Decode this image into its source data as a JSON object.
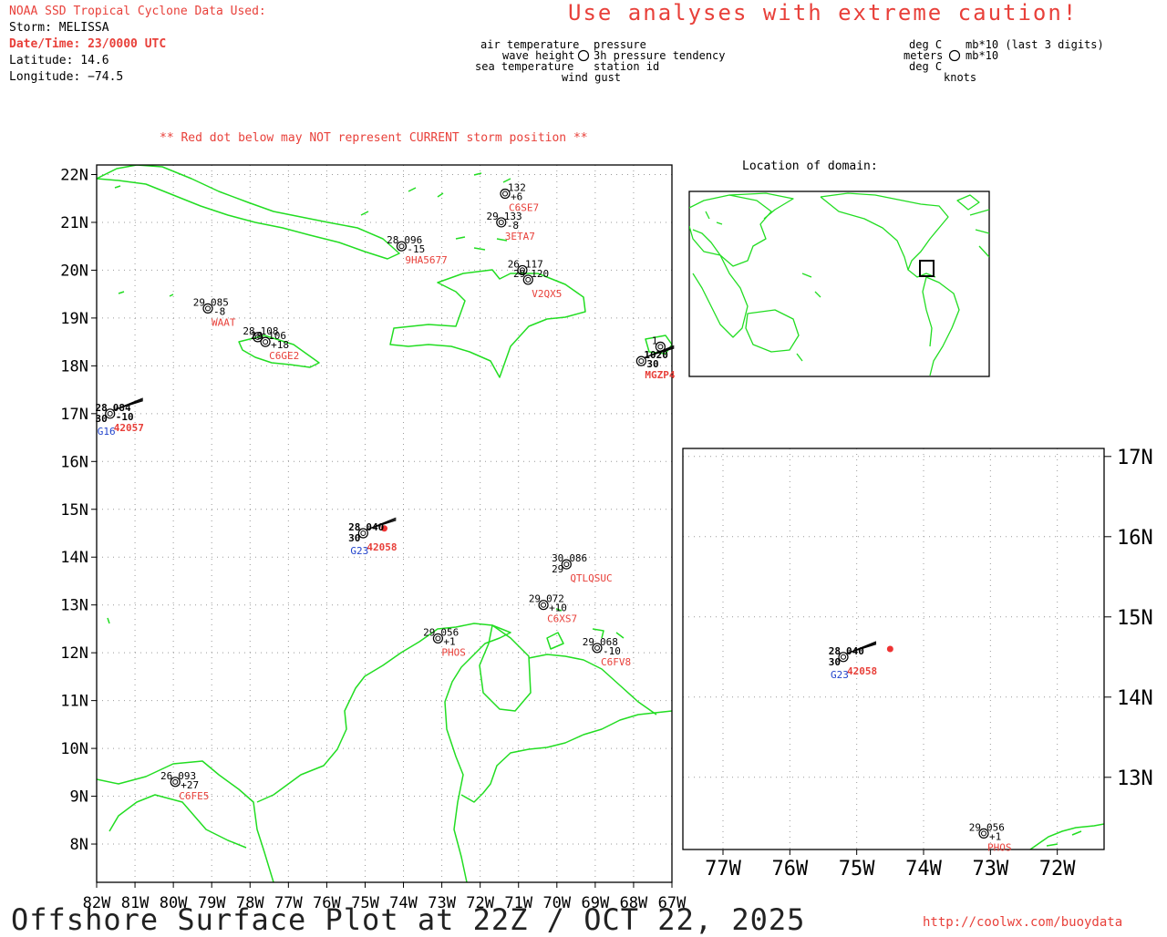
{
  "header": {
    "source": "NOAA SSD Tropical Cyclone Data Used:",
    "storm": "Storm: MELISSA",
    "datetime": "Date/Time: 23/0000 UTC",
    "latitude": "Latitude: 14.6",
    "longitude": "Longitude: −74.5"
  },
  "caution": "Use analyses with extreme caution!",
  "legend": {
    "air_temperature": "air temperature",
    "wave_height": "wave height",
    "sea_temperature": "sea temperature",
    "pressure": "pressure",
    "pressure_tendency": "3h pressure tendency",
    "station_id": "station id",
    "wind_gust": "wind gust",
    "deg_c_1": "deg C",
    "meters": "meters",
    "deg_c_2": "deg C",
    "mb_last3": "mb*10 (last 3 digits)",
    "mb_10": "mb*10",
    "knots": "knots"
  },
  "warning": "** Red dot below may NOT represent CURRENT storm position **",
  "inset_title": "Location of domain:",
  "main_map": {
    "lon_range": [
      -82,
      -67
    ],
    "lat_range": [
      7.2,
      22.2
    ],
    "lon_ticks": [
      -82,
      -81,
      -80,
      -79,
      -78,
      -77,
      -76,
      -75,
      -74,
      -73,
      -72,
      -71,
      -70,
      -69,
      -68,
      -67
    ],
    "lon_labels": [
      "82W",
      "81W",
      "80W",
      "79W",
      "78W",
      "77W",
      "76W",
      "75W",
      "74W",
      "73W",
      "72W",
      "71W",
      "70W",
      "69W",
      "68W",
      "67W"
    ],
    "lat_ticks": [
      8,
      9,
      10,
      11,
      12,
      13,
      14,
      15,
      16,
      17,
      18,
      19,
      20,
      21,
      22
    ],
    "lat_labels": [
      "8N",
      "9N",
      "10N",
      "11N",
      "12N",
      "13N",
      "14N",
      "15N",
      "16N",
      "17N",
      "18N",
      "19N",
      "20N",
      "21N",
      "22N"
    ],
    "storm": {
      "lon": -74.5,
      "lat": 14.6
    },
    "stations": [
      {
        "lon": -71.35,
        "lat": 21.6,
        "top_right": "132",
        "mid_right": "+6",
        "id": "C6SE7"
      },
      {
        "lon": -71.45,
        "lat": 21.0,
        "top_left": "29",
        "top_right": "133",
        "mid_right": "-8",
        "id": "3ETA7"
      },
      {
        "lon": -74.05,
        "lat": 20.5,
        "top_left": "28",
        "top_right": "096",
        "mid_right": "-15",
        "id": "9HA5677"
      },
      {
        "lon": -70.9,
        "lat": 20.0,
        "top_left": "26",
        "top_right": "117",
        "id": ""
      },
      {
        "lon": -70.75,
        "lat": 19.8,
        "top_left": "29",
        "top_right": "120",
        "id": "V2QX5"
      },
      {
        "lon": -79.1,
        "lat": 19.2,
        "top_left": "29",
        "top_right": "085",
        "mid_right": "-8",
        "id": "WAAT"
      },
      {
        "lon": -77.8,
        "lat": 18.6,
        "top_left": "28",
        "top_right": "108",
        "id": ""
      },
      {
        "lon": -77.6,
        "lat": 18.5,
        "top_left": "28",
        "top_right": "106",
        "mid_right": "+18",
        "id": "C6GE2"
      },
      {
        "lon": -67.3,
        "lat": 18.4,
        "top_left": "1",
        "top_right": "",
        "id": ""
      },
      {
        "lon": -67.8,
        "lat": 18.1,
        "top_right": "1020",
        "mid_right": "30",
        "id": "MGZP4",
        "bold": true
      },
      {
        "lon": -81.65,
        "lat": 17.0,
        "top_left": "28",
        "top_right": "084",
        "bottom_left": "30",
        "mid_right": "-10",
        "id": "42057",
        "id2": "G16",
        "bold": true
      },
      {
        "lon": -75.05,
        "lat": 14.5,
        "top_left": "28",
        "top_right": "040",
        "bottom_left": "30",
        "id": "42058",
        "id2": "G23",
        "bold": true
      },
      {
        "lon": -69.75,
        "lat": 13.85,
        "top_left": "30",
        "top_right": "086",
        "bottom_left": "29",
        "id": "QTLQSUC"
      },
      {
        "lon": -70.35,
        "lat": 13.0,
        "top_left": "29",
        "top_right": "072",
        "mid_right": "+10",
        "id": "C6XS7"
      },
      {
        "lon": -73.1,
        "lat": 12.3,
        "top_left": "29",
        "top_right": "056",
        "mid_right": "+1",
        "id": "PHOS"
      },
      {
        "lon": -68.95,
        "lat": 12.1,
        "top_left": "29",
        "top_right": "068",
        "mid_right": "-10",
        "id": "C6FV8"
      },
      {
        "lon": -79.95,
        "lat": 9.3,
        "top_left": "26",
        "top_right": "093",
        "mid_right": "+27",
        "id": "C6FE5"
      }
    ]
  },
  "zoom_map": {
    "lon_range": [
      -77.6,
      -71.3
    ],
    "lat_range": [
      12.1,
      17.1
    ],
    "lon_ticks": [
      -77,
      -76,
      -75,
      -74,
      -73,
      -72
    ],
    "lon_labels": [
      "77W",
      "76W",
      "75W",
      "74W",
      "73W",
      "72W"
    ],
    "lat_ticks": [
      13,
      14,
      15,
      16,
      17
    ],
    "lat_labels": [
      "13N",
      "14N",
      "15N",
      "16N",
      "17N"
    ],
    "storm": {
      "lon": -74.5,
      "lat": 14.6
    },
    "stations": [
      {
        "lon": -75.2,
        "lat": 14.5,
        "top_left": "28",
        "top_right": "040",
        "bottom_left": "30",
        "id": "42058",
        "id2": "G23",
        "bold": true
      },
      {
        "lon": -73.1,
        "lat": 12.3,
        "top_left": "29",
        "top_right": "056",
        "mid_right": "+1",
        "id": "PHOS"
      }
    ]
  },
  "footer": {
    "title": "Offshore Surface Plot at 22Z / OCT 22, 2025",
    "url": "http://coolwx.com/buoydata"
  },
  "colors": {
    "coast": "#22dd22",
    "station_id": "#e8403a",
    "storm": "#ee3333",
    "grid": "#999999",
    "alt_id": "#2244cc"
  }
}
